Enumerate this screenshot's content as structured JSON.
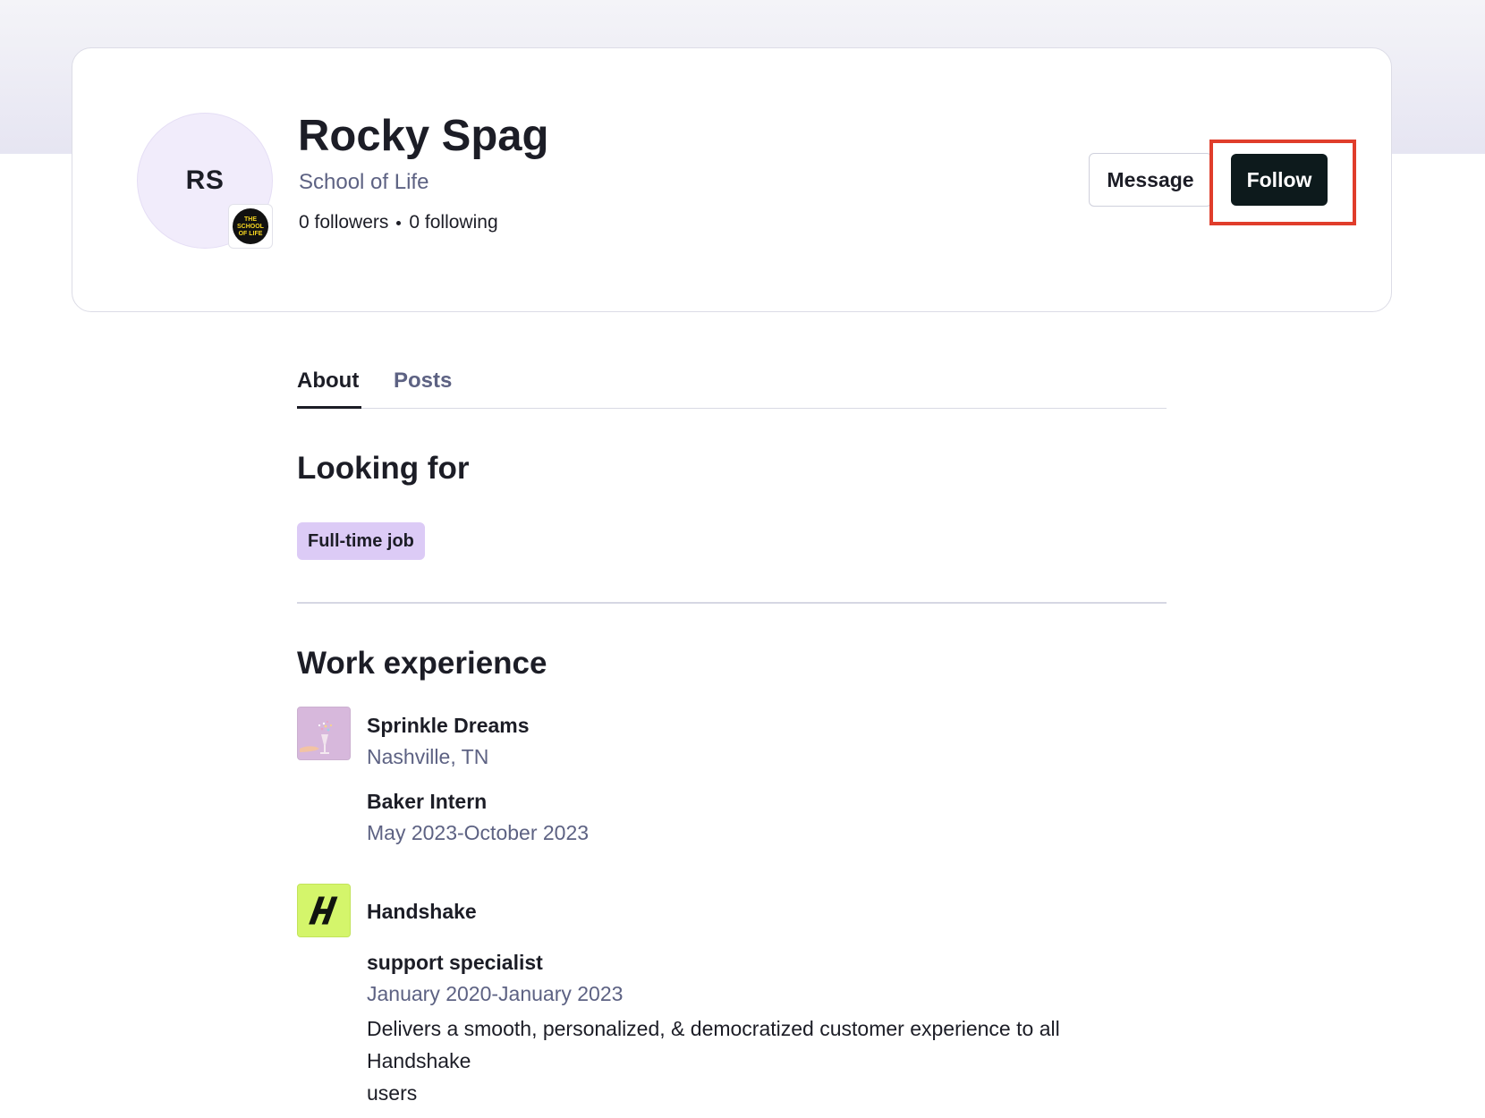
{
  "profile": {
    "initials": "RS",
    "name": "Rocky Spag",
    "school": "School of Life",
    "school_badge_text": "THE SCHOOL OF LIFE",
    "followers": "0 followers",
    "following": "0 following"
  },
  "actions": {
    "message_label": "Message",
    "follow_label": "Follow"
  },
  "tabs": [
    {
      "label": "About",
      "active": true
    },
    {
      "label": "Posts",
      "active": false
    }
  ],
  "looking_for": {
    "title": "Looking for",
    "tags": [
      "Full-time job"
    ]
  },
  "work_experience": {
    "title": "Work experience",
    "items": [
      {
        "company": "Sprinkle Dreams",
        "location": "Nashville, TN",
        "role": "Baker Intern",
        "dates": "May 2023-October 2023"
      },
      {
        "company": "Handshake",
        "role": "support specialist",
        "dates": "January 2020-January 2023",
        "description": "Delivers a smooth, personalized, & democratized customer experience to all Handshake",
        "description_cont": "users"
      }
    ]
  },
  "colors": {
    "accent_highlight": "#e03d2b",
    "follow_button": "#0d1a1c",
    "tag_bg": "#dccbf6",
    "handshake_logo": "#d4f56b"
  }
}
